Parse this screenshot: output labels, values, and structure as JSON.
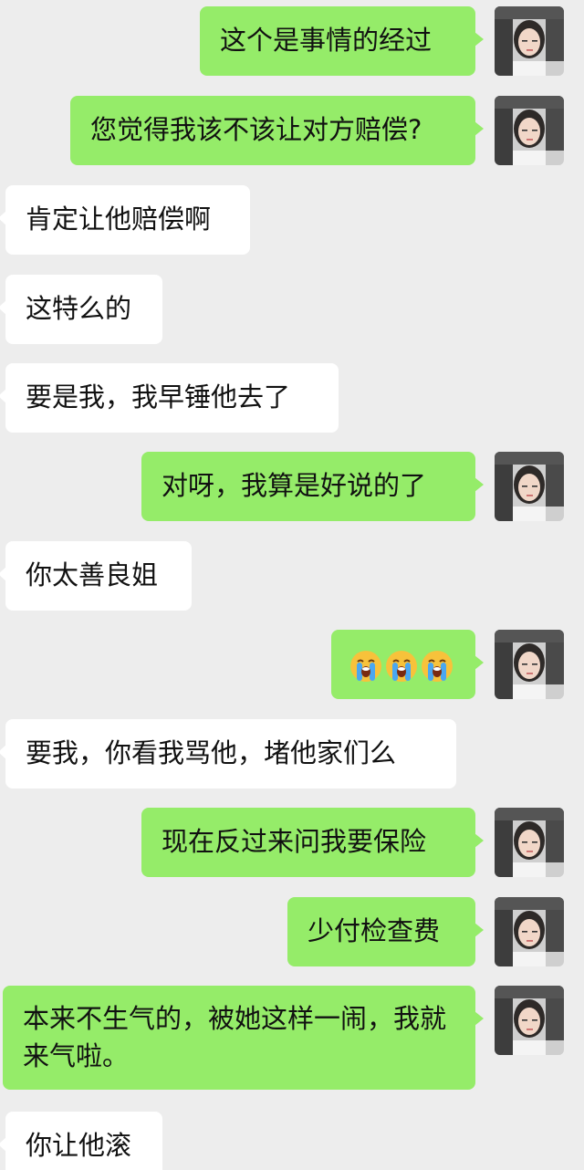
{
  "messages": [
    {
      "side": "out",
      "text": "这个是事情的经过",
      "avatar": "user-avatar"
    },
    {
      "side": "out",
      "text": "您觉得我该不该让对方赔偿?",
      "avatar": "user-avatar"
    },
    {
      "side": "in",
      "text": "肯定让他赔偿啊"
    },
    {
      "side": "in",
      "text": "这特么的"
    },
    {
      "side": "in",
      "text": "要是我，我早锤他去了"
    },
    {
      "side": "out",
      "text": "对呀，我算是好说的了",
      "avatar": "user-avatar"
    },
    {
      "side": "in",
      "text": "你太善良姐"
    },
    {
      "side": "out",
      "emoji": [
        "loudly-crying-face-icon",
        "loudly-crying-face-icon",
        "loudly-crying-face-icon"
      ],
      "avatar": "user-avatar"
    },
    {
      "side": "in",
      "text": "要我，你看我骂他，堵他家们么"
    },
    {
      "side": "out",
      "text": "现在反过来问我要保险",
      "avatar": "user-avatar"
    },
    {
      "side": "out",
      "text": "少付检查费",
      "avatar": "user-avatar"
    },
    {
      "side": "out",
      "text": "本来不生气的，被她这样一闹，我就来气啦。",
      "avatar": "user-avatar"
    },
    {
      "side": "in",
      "text": "你让他滚"
    }
  ],
  "colors": {
    "background": "#ededed",
    "outgoing_bubble": "#95ec69",
    "incoming_bubble": "#ffffff",
    "text": "#111111"
  }
}
